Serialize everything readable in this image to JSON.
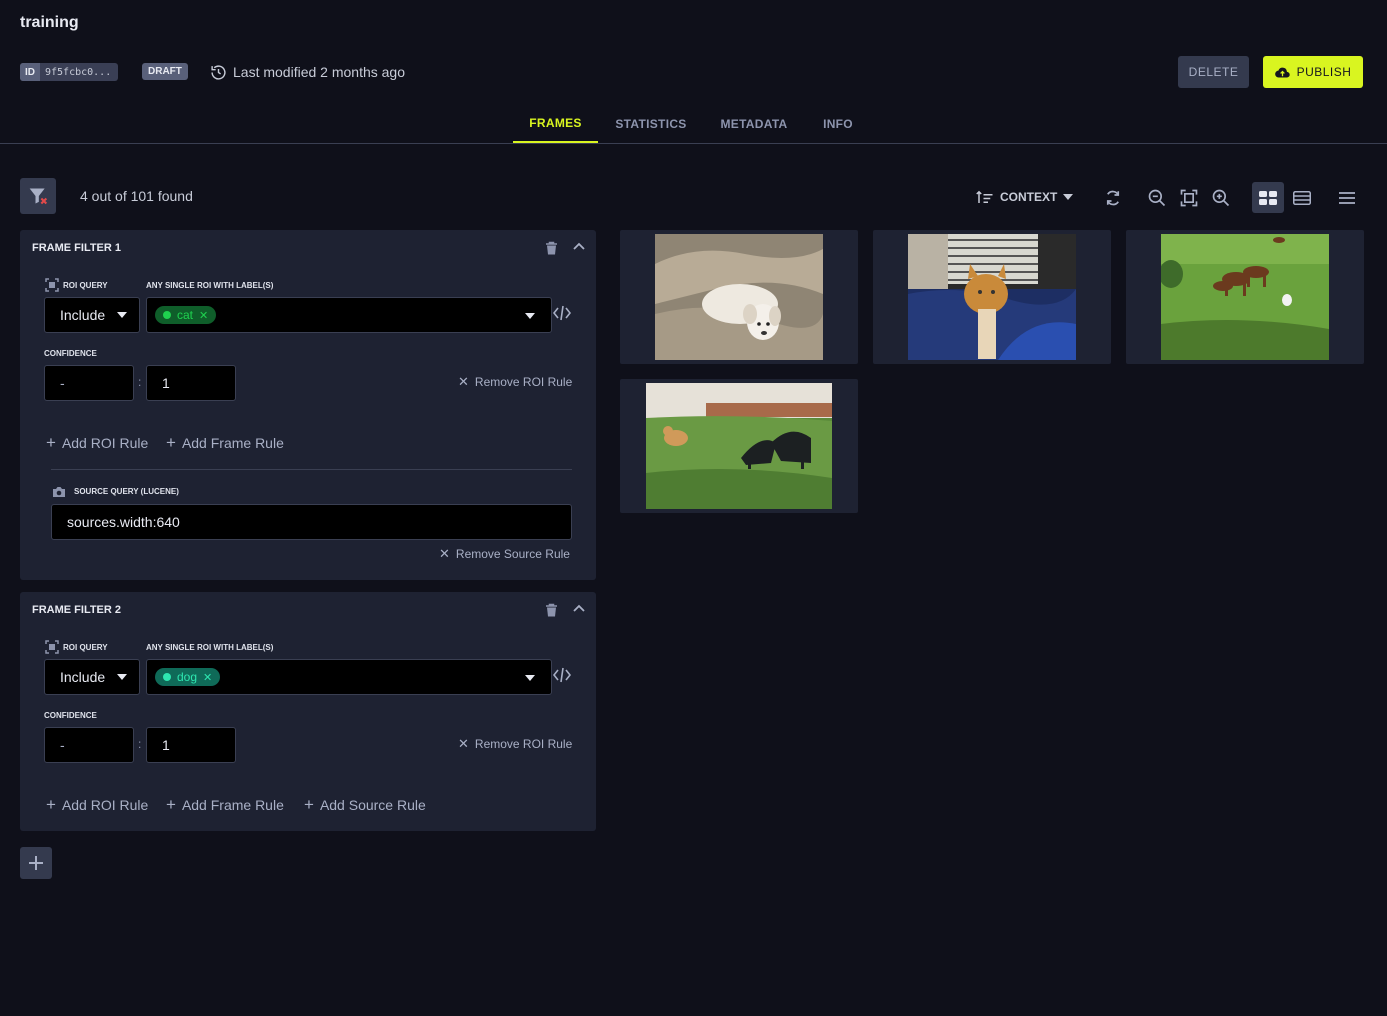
{
  "header": {
    "title": "training",
    "id_label": "ID",
    "id_value": "9f5fcbc0...",
    "status_badge": "DRAFT",
    "last_modified": "Last modified 2 months ago",
    "delete_label": "DELETE",
    "publish_label": "PUBLISH"
  },
  "tabs": [
    {
      "label": "FRAMES",
      "active": true
    },
    {
      "label": "STATISTICS",
      "active": false
    },
    {
      "label": "METADATA",
      "active": false
    },
    {
      "label": "INFO",
      "active": false
    }
  ],
  "toolbar": {
    "found_text": "4 out of 101 found",
    "sort_label": "CONTEXT"
  },
  "filters": [
    {
      "title": "FRAME FILTER 1",
      "roi_query_label": "ROI QUERY",
      "labels_label": "ANY SINGLE ROI WITH LABEL(S)",
      "include_value": "Include",
      "chip": "cat",
      "confidence_label": "CONFIDENCE",
      "conf_min": "-",
      "conf_max": "1",
      "remove_roi": "Remove ROI Rule",
      "add_roi": "Add ROI Rule",
      "add_frame": "Add Frame Rule",
      "source_label": "SOURCE QUERY (LUCENE)",
      "source_value": "sources.width:640",
      "remove_source": "Remove Source Rule"
    },
    {
      "title": "FRAME FILTER 2",
      "roi_query_label": "ROI QUERY",
      "labels_label": "ANY SINGLE ROI WITH LABEL(S)",
      "include_value": "Include",
      "chip": "dog",
      "confidence_label": "CONFIDENCE",
      "conf_min": "-",
      "conf_max": "1",
      "remove_roi": "Remove ROI Rule",
      "add_roi": "Add ROI Rule",
      "add_frame": "Add Frame Rule",
      "add_source": "Add Source Rule"
    }
  ],
  "thumbnails": [
    {
      "name": "puppy on cushion"
    },
    {
      "name": "cat on couch"
    },
    {
      "name": "horses in field"
    },
    {
      "name": "cat and dogs on grass"
    }
  ],
  "colors": {
    "accent": "#d9f520",
    "background": "#0f101a",
    "panel": "#1e2232",
    "cat_chip": "#1fd14f",
    "dog_chip": "#2ee6b0"
  }
}
